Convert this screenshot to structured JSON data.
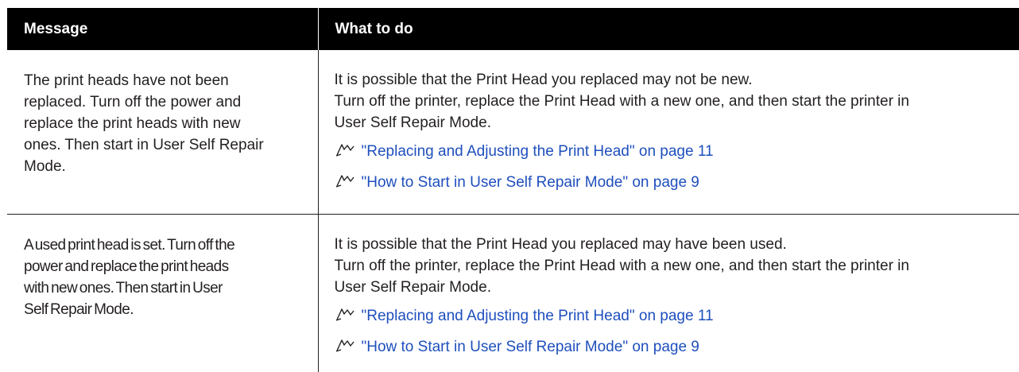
{
  "table": {
    "headers": [
      "Message",
      "What to do"
    ],
    "rows": [
      {
        "message_lines": [
          "The print heads have not been",
          "replaced. Turn off the power and",
          "replace the print heads with new",
          "ones. Then start in User Self Repair",
          "Mode."
        ],
        "action_lines": [
          "It is possible that the Print Head you replaced may not be new.",
          "Turn off the printer, replace the Print Head with a new one, and then start the printer in",
          "User Self Repair Mode."
        ],
        "links": [
          {
            "icon": "reference-pointer-icon",
            "text": "\"Replacing and Adjusting the Print Head\" on page 11"
          },
          {
            "icon": "reference-pointer-icon",
            "text": "\"How to Start in User Self Repair Mode\" on page 9"
          }
        ]
      },
      {
        "message_lines": [
          "A used print head is set. Turn off the",
          "power and replace the print heads",
          "with new ones. Then start in User",
          "Self Repair Mode."
        ],
        "action_lines": [
          "It is possible that the Print Head you replaced may have been used.",
          "Turn off the printer, replace the Print Head with a new one, and then start the printer in",
          "User Self Repair Mode."
        ],
        "links": [
          {
            "icon": "reference-pointer-icon",
            "text": "\"Replacing and Adjusting the Print Head\" on page 11"
          },
          {
            "icon": "reference-pointer-icon",
            "text": "\"How to Start in User Self Repair Mode\" on page 9"
          }
        ]
      }
    ]
  },
  "colors": {
    "header_bg": "#000000",
    "header_text": "#ffffff",
    "body_text": "#231f20",
    "link": "#1f4fbd"
  }
}
